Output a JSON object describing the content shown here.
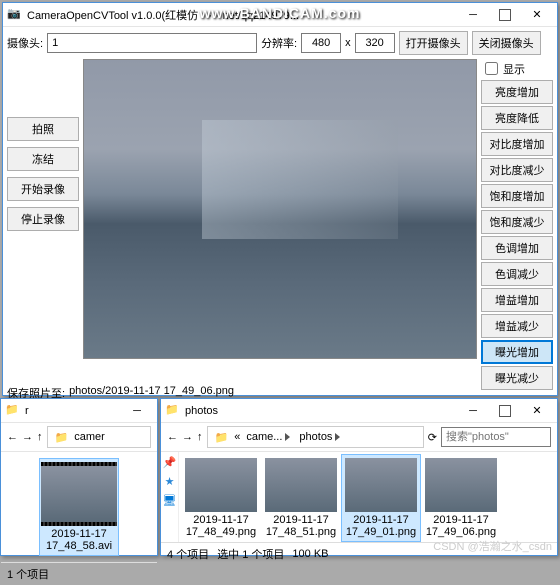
{
  "watermark": "www.BANDICAM.com",
  "main_win": {
    "title": "CameraOpenCVTool v1.0.0(红模仿 ····· net/qq214979...",
    "camera_label": "摄像头:",
    "camera_value": "1",
    "res_label": "分辨率:",
    "res_w": "480",
    "res_x": "x",
    "res_h": "320",
    "open_btn": "打开摄像头",
    "close_btn": "关闭摄像头",
    "show_cb": "显示",
    "left_buttons": [
      "拍照",
      "冻结",
      "开始录像",
      "停止录像"
    ],
    "right_buttons": [
      "亮度增加",
      "亮度降低",
      "对比度增加",
      "对比度减少",
      "饱和度增加",
      "饱和度减少",
      "色调增加",
      "色调减少",
      "增益增加",
      "增益减少",
      "曝光增加",
      "曝光减少"
    ],
    "selected_right": 10,
    "save_label": "保存照片至:",
    "save_path": "photos/2019-11-17 17_49_06.png"
  },
  "exp1": {
    "title": "r",
    "crumb": "camer",
    "file": {
      "name": "2019-11-17 17_48_58.avi"
    },
    "status": "1 个项目"
  },
  "exp2": {
    "title": "photos",
    "crumb_parts": [
      "came...",
      "photos"
    ],
    "search_ph": "搜索\"photos\"",
    "files": [
      {
        "name": "2019-11-17 17_48_49.png"
      },
      {
        "name": "2019-11-17 17_48_51.png"
      },
      {
        "name": "2019-11-17 17_49_01.png",
        "sel": true
      },
      {
        "name": "2019-11-17 17_49_06.png"
      }
    ],
    "status1": "4 个项目",
    "status2": "选中 1 个项目",
    "status3": "100 KB"
  },
  "csdn": "CSDN @浩瀚之水_csdn"
}
